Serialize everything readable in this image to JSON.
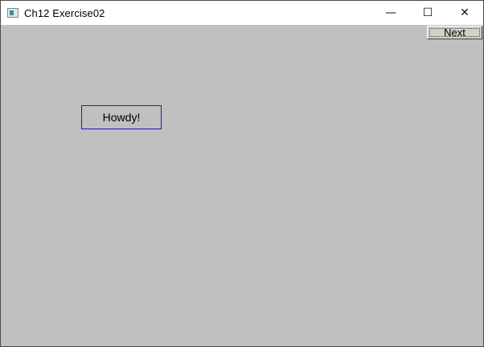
{
  "window": {
    "title": "Ch12  Exercise02",
    "controls": {
      "minimize": "—",
      "maximize": "☐",
      "close": "✕"
    }
  },
  "client": {
    "next_button_label": "Next",
    "box_text": "Howdy!"
  },
  "colors": {
    "client_background": "#c0c0c0",
    "box_border": "#1a1acc",
    "button_face": "#d4d0c8"
  }
}
